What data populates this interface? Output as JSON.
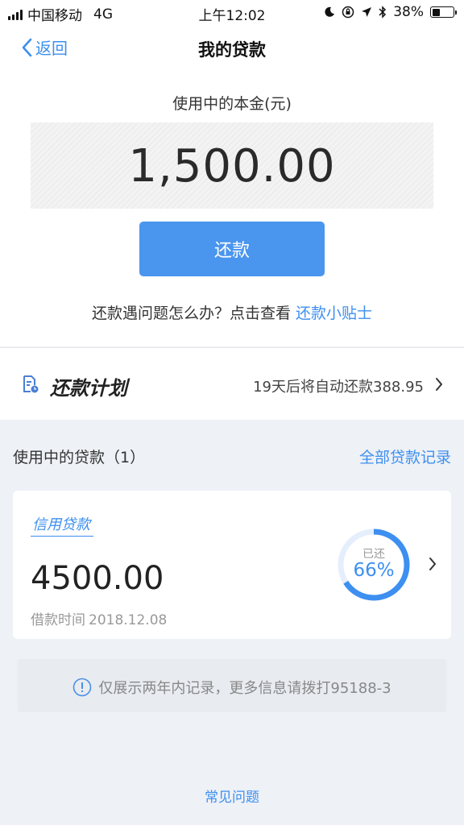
{
  "status_bar": {
    "carrier": "中国移动",
    "network": "4G",
    "time": "上午12:02",
    "battery": "38%",
    "battery_level": 0.38
  },
  "nav": {
    "back_label": "返回",
    "title": "我的贷款"
  },
  "summary": {
    "principal_label": "使用中的本金(元)",
    "principal_amount": "1,500.00",
    "repay_button": "还款",
    "tips_text": "还款遇问题怎么办？点击查看",
    "tips_link": "还款小贴士"
  },
  "plan": {
    "title": "还款计划",
    "info": "19天后将自动还款388.95"
  },
  "loans": {
    "header": "使用中的贷款（1）",
    "all_records": "全部贷款记录",
    "items": [
      {
        "type": "信用贷款",
        "amount": "4500.00",
        "date_label": "借款时间",
        "date": "2018.12.08",
        "repaid_label": "已还",
        "repaid_pct_text": "66%",
        "repaid_fraction": 0.66
      }
    ]
  },
  "notice": {
    "text": "仅展示两年内记录，更多信息请拨打95188-3"
  },
  "footer": {
    "faq": "常见问题"
  },
  "colors": {
    "accent": "#3d8ff0",
    "button": "#4a95ee",
    "background": "#eef1f6"
  }
}
